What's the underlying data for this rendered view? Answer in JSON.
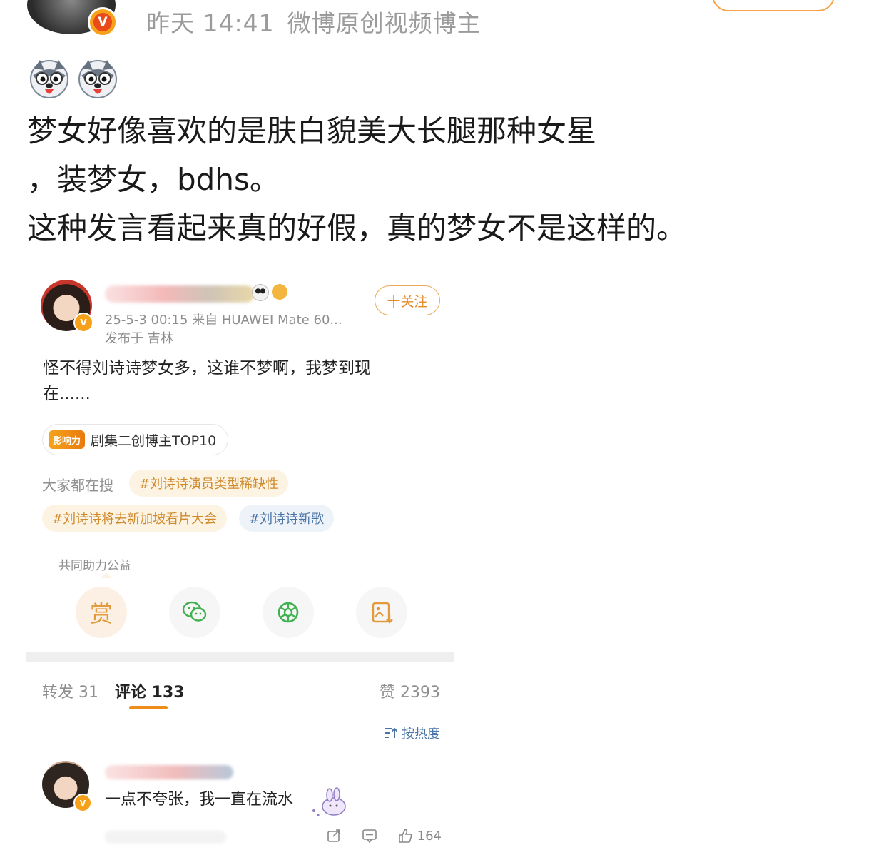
{
  "post": {
    "time": "昨天 14:41",
    "source": "微博原创视频博主",
    "emojis": [
      "husky-emoji",
      "husky-emoji"
    ],
    "text_lines": [
      "梦女好像喜欢的是肤白貌美大长腿那种女星",
      "，装梦女，bdhs。",
      "这种发言看起来真的好假，真的梦女不是这样的。"
    ]
  },
  "embedded": {
    "meta_line": "25-5-3 00:15  来自 HUAWEI Mate 60...",
    "location": "发布于 吉林",
    "follow_label": "十关注",
    "text": "怪不得刘诗诗梦女多，这谁不梦啊，我梦到现在......",
    "badge_logo": "影响力",
    "badge_label": "剧集二创博主TOP10",
    "search_label": "大家都在搜",
    "tags": [
      "#刘诗诗演员类型稀缺性",
      "#刘诗诗将去新加坡看片大会",
      "#刘诗诗新歌"
    ],
    "charity_label": "共同助力公益",
    "reward_label": "赏",
    "stats": {
      "repost": "转发 31",
      "comment": "评论 133",
      "like": "赞 2393"
    },
    "sort_label": "按热度",
    "comment": {
      "text": "一点不夸张，我一直在流水",
      "like_count": "164"
    }
  },
  "colors": {
    "accent_orange": "#f08c1a",
    "link_blue": "#4b74a6",
    "meta_gray": "#9b9b9b"
  }
}
